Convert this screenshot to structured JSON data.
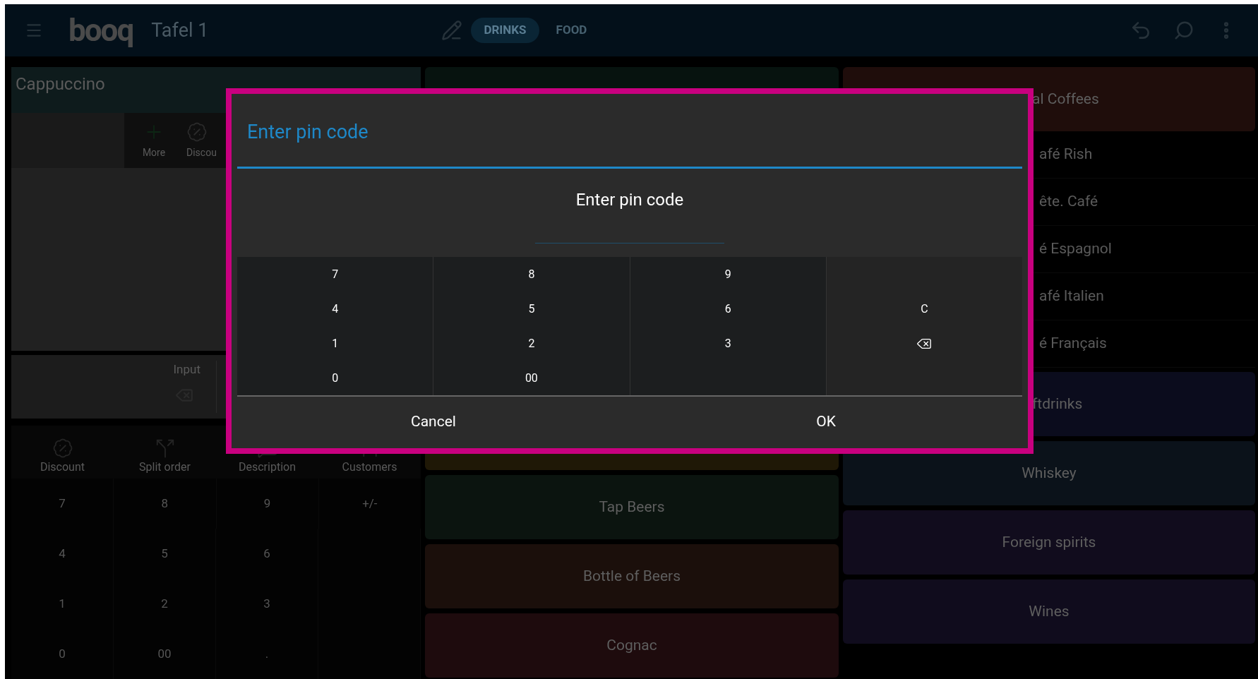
{
  "top_bar": {
    "logo": "booq",
    "title": "Tafel 1",
    "tabs": [
      {
        "label": "DRINKS",
        "selected": true
      },
      {
        "label": "FOOD",
        "selected": false
      }
    ]
  },
  "order_panel": {
    "item": "Cappuccino",
    "item_actions": [
      {
        "kind": "more",
        "label": "More"
      },
      {
        "kind": "discount",
        "label": "Discou"
      }
    ],
    "input_label": "Input",
    "actions": [
      {
        "kind": "discount",
        "label": "Discount"
      },
      {
        "kind": "split",
        "label": "Split order"
      },
      {
        "kind": "description",
        "label": "Description"
      },
      {
        "kind": "customers",
        "label": "Customers"
      }
    ],
    "keypad": [
      [
        {
          "kind": "key",
          "label": "7"
        },
        {
          "kind": "key",
          "label": "8"
        },
        {
          "kind": "key",
          "label": "9"
        },
        {
          "kind": "key",
          "label": "+/-"
        }
      ],
      [
        {
          "kind": "key",
          "label": "4"
        },
        {
          "kind": "key",
          "label": "5"
        },
        {
          "kind": "key",
          "label": "6"
        },
        {
          "kind": "blank"
        }
      ],
      [
        {
          "kind": "key",
          "label": "1"
        },
        {
          "kind": "key",
          "label": "2"
        },
        {
          "kind": "key",
          "label": "3"
        },
        {
          "kind": "blank"
        }
      ],
      [
        {
          "kind": "key",
          "label": "0"
        },
        {
          "kind": "key",
          "label": "00"
        },
        {
          "kind": "key",
          "label": "."
        },
        {
          "kind": "blank"
        }
      ]
    ]
  },
  "categories": {
    "middle": [
      {
        "kind": "tile",
        "color": "#07130f"
      },
      {
        "kind": "tile",
        "color": "#1f1806"
      },
      {
        "kind": "tile",
        "label": "Tap Beers",
        "color": "#0b140f"
      },
      {
        "kind": "tile",
        "label": "Bottle of Beers",
        "color": "#1b0f0b"
      },
      {
        "kind": "tile",
        "label": "Cognac",
        "color": "#1e0b0d"
      }
    ],
    "right": [
      {
        "kind": "tile",
        "label": "al Coffees",
        "color": "#1f0d0b"
      },
      {
        "kind": "row",
        "label": "afé Rish"
      },
      {
        "kind": "row",
        "label": "ête. Café"
      },
      {
        "kind": "row",
        "label": "é Espagnol"
      },
      {
        "kind": "row",
        "label": "afé Italien"
      },
      {
        "kind": "row",
        "label": "é Français"
      },
      {
        "kind": "tile",
        "label": "ftdrinks",
        "color": "#0b0c1d"
      },
      {
        "kind": "tile",
        "label": "Whiskey",
        "color": "#0b121a"
      },
      {
        "kind": "tile",
        "label": "Foreign spirits",
        "color": "#110c1d"
      },
      {
        "kind": "tile",
        "label": "Wines",
        "color": "#100c1d"
      }
    ]
  },
  "dialog": {
    "title": "Enter pin code",
    "prompt": "Enter pin code",
    "keypad": [
      [
        {
          "kind": "key",
          "label": "7"
        },
        {
          "kind": "key",
          "label": "8"
        },
        {
          "kind": "key",
          "label": "9"
        },
        {
          "kind": "blank"
        }
      ],
      [
        {
          "kind": "key",
          "label": "4"
        },
        {
          "kind": "key",
          "label": "5"
        },
        {
          "kind": "key",
          "label": "6"
        },
        {
          "kind": "key",
          "label": "C"
        }
      ],
      [
        {
          "kind": "key",
          "label": "1"
        },
        {
          "kind": "key",
          "label": "2"
        },
        {
          "kind": "key",
          "label": "3"
        },
        {
          "kind": "backspace"
        }
      ],
      [
        {
          "kind": "key",
          "label": "0"
        },
        {
          "kind": "key",
          "label": "00"
        },
        {
          "kind": "blank"
        },
        {
          "kind": "blank"
        }
      ]
    ],
    "buttons": [
      "Cancel",
      "OK"
    ]
  }
}
